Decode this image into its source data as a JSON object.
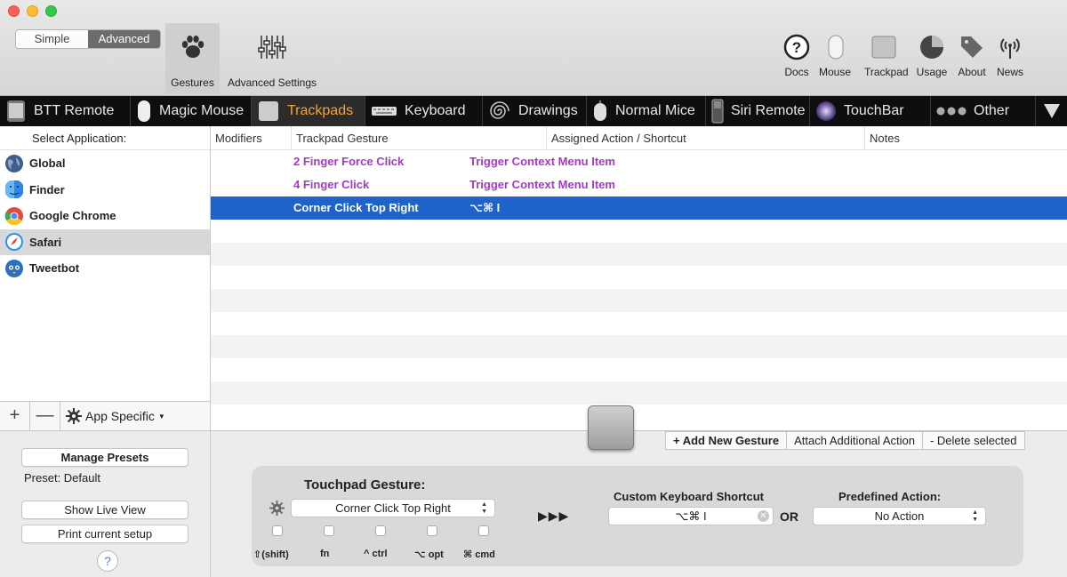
{
  "window": {
    "mode_simple": "Simple",
    "mode_advanced": "Advanced"
  },
  "toolbar": {
    "gestures": "Gestures",
    "advanced_settings": "Advanced Settings",
    "right": [
      {
        "label": "Docs",
        "icon": "question-icon"
      },
      {
        "label": "Mouse",
        "icon": "mouse-icon"
      },
      {
        "label": "Trackpad",
        "icon": "trackpad-icon"
      },
      {
        "label": "Usage",
        "icon": "pie-chart-icon"
      },
      {
        "label": "About",
        "icon": "tag-icon"
      },
      {
        "label": "News",
        "icon": "antenna-icon"
      }
    ]
  },
  "tabs": [
    {
      "label": "BTT Remote",
      "icon": "phone-icon"
    },
    {
      "label": "Magic Mouse",
      "icon": "magic-mouse-icon"
    },
    {
      "label": "Trackpads",
      "icon": "trackpad-icon",
      "active": true
    },
    {
      "label": "Keyboard",
      "icon": "keyboard-icon"
    },
    {
      "label": "Drawings",
      "icon": "spiral-icon"
    },
    {
      "label": "Normal Mice",
      "icon": "mouse-icon"
    },
    {
      "label": "Siri Remote",
      "icon": "remote-icon"
    },
    {
      "label": "TouchBar",
      "icon": "touchbar-icon"
    },
    {
      "label": "Other",
      "icon": "dots-icon"
    }
  ],
  "applist": {
    "header": "Select Application:",
    "items": [
      {
        "label": "Global",
        "icon": "globe-icon"
      },
      {
        "label": "Finder",
        "icon": "finder-icon"
      },
      {
        "label": "Google Chrome",
        "icon": "chrome-icon"
      },
      {
        "label": "Safari",
        "icon": "safari-icon",
        "selected": true
      },
      {
        "label": "Tweetbot",
        "icon": "tweetbot-icon"
      }
    ],
    "add": "+",
    "remove": "—",
    "app_specific": "App Specific"
  },
  "table": {
    "columns": [
      "Modifiers",
      "Trackpad Gesture",
      "Assigned Action / Shortcut",
      "Notes"
    ],
    "rows": [
      {
        "modifiers": "",
        "gesture": "2 Finger Force Click",
        "action": "Trigger Context Menu Item",
        "notes": ""
      },
      {
        "modifiers": "",
        "gesture": "4 Finger Click",
        "action": "Trigger Context Menu Item",
        "notes": ""
      },
      {
        "modifiers": "",
        "gesture": "Corner Click Top Right",
        "action": "⌥⌘ I",
        "notes": "",
        "selected": true
      }
    ]
  },
  "actions": {
    "add_gesture": "+ Add New Gesture",
    "attach": "Attach Additional Action",
    "delete": "- Delete selected"
  },
  "left_bottom": {
    "manage_presets": "Manage Presets",
    "preset": "Preset: Default",
    "show_live_view": "Show Live View",
    "print_setup": "Print current setup",
    "help": "?"
  },
  "panel": {
    "touchpad_gesture_label": "Touchpad Gesture:",
    "gesture_value": "Corner Click Top Right",
    "modifiers": [
      "⇧(shift)",
      "fn",
      "^ ctrl",
      "⌥ opt",
      "⌘ cmd"
    ],
    "arrows": "▶▶▶",
    "shortcut_label": "Custom Keyboard Shortcut",
    "shortcut_value": "⌥⌘ I",
    "or": "OR",
    "predefined_label": "Predefined Action:",
    "predefined_value": "No Action"
  }
}
